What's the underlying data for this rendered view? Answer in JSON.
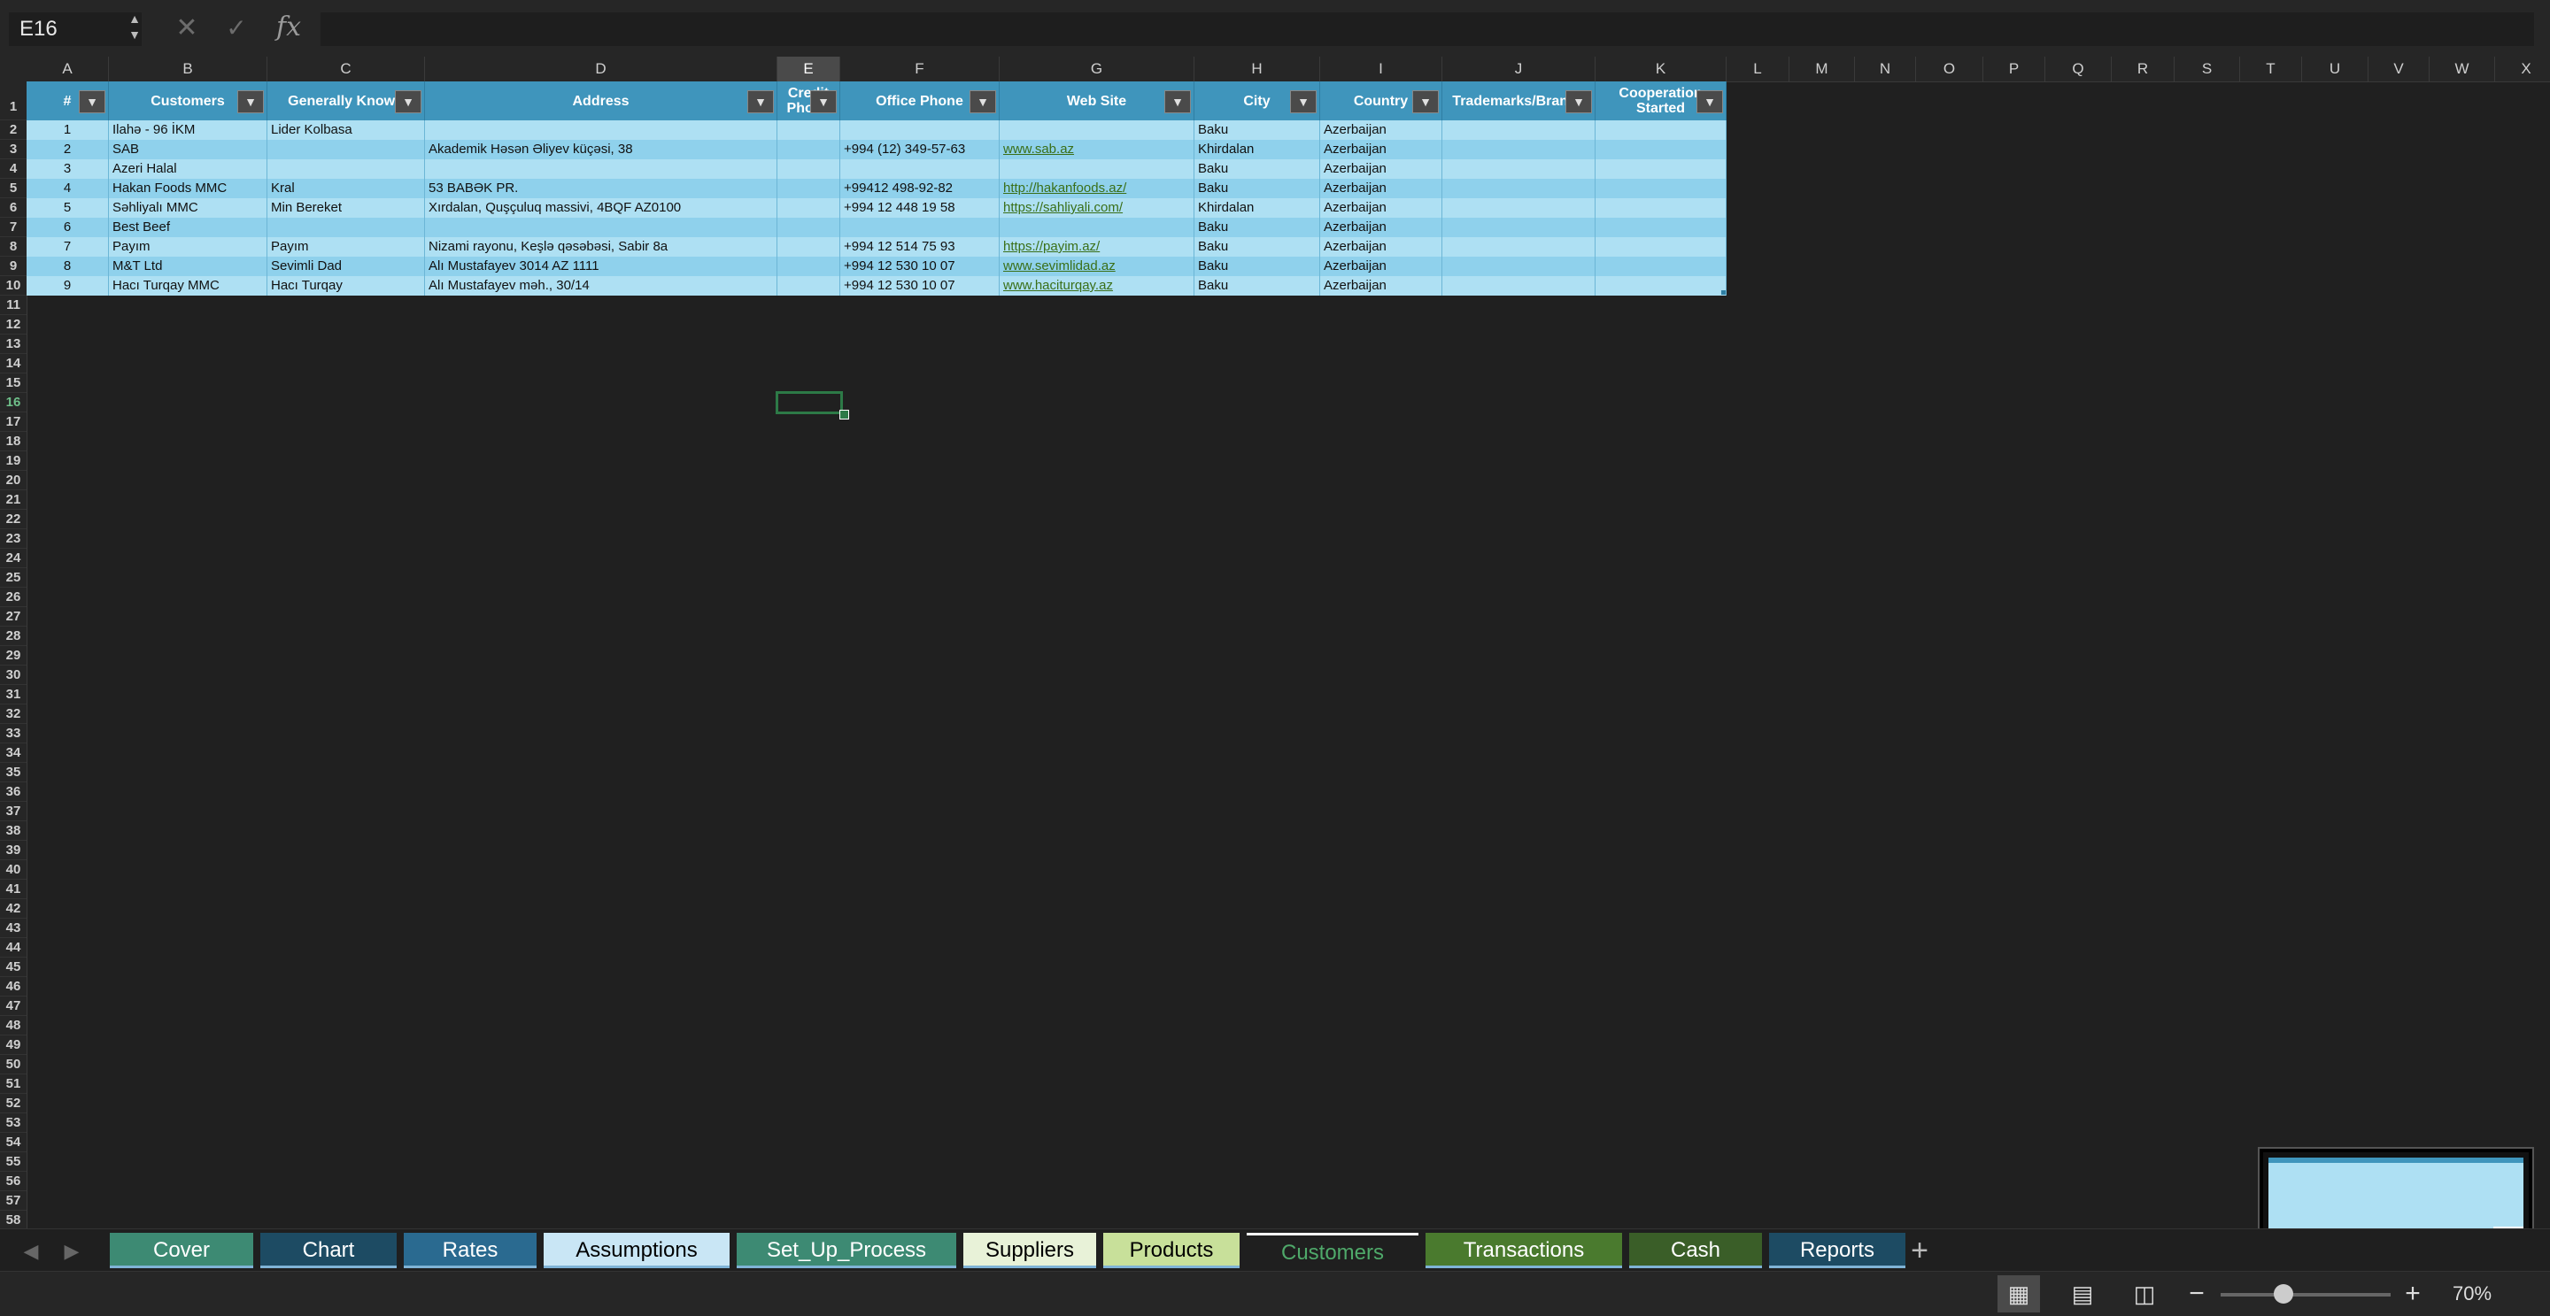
{
  "formula_bar": {
    "cell_ref": "E16",
    "fx_label": "fx",
    "cancel_glyph": "✕",
    "enter_glyph": "✓",
    "formula": ""
  },
  "columns": [
    "A",
    "B",
    "C",
    "D",
    "E",
    "F",
    "G",
    "H",
    "I",
    "J",
    "K",
    "L",
    "M",
    "N",
    "O",
    "P",
    "Q",
    "R",
    "S",
    "T",
    "U",
    "V",
    "W",
    "X"
  ],
  "selected_column": "E",
  "rows": [
    "1",
    "2",
    "3",
    "4",
    "5",
    "6",
    "7",
    "8",
    "9",
    "10",
    "11",
    "12",
    "13",
    "14",
    "15",
    "16",
    "17",
    "18",
    "19",
    "20",
    "21",
    "22",
    "23",
    "24",
    "25",
    "26",
    "27",
    "28",
    "29",
    "30",
    "31",
    "32",
    "33",
    "34",
    "35",
    "36",
    "37",
    "38",
    "39",
    "40",
    "41",
    "42",
    "43",
    "44",
    "45",
    "46",
    "47",
    "48",
    "49",
    "50",
    "51",
    "52",
    "53",
    "54",
    "55",
    "56",
    "57",
    "58"
  ],
  "selected_row": "16",
  "table": {
    "headers": [
      "#",
      "Customers",
      "Generally Known",
      "Address",
      "Credit\nPhone",
      "Office Phone",
      "Web Site",
      "City",
      "Country",
      "Trademarks/Brands",
      "Cooperation\nStarted"
    ],
    "rows": [
      [
        "1",
        "Ilahə - 96 İKM",
        "Lider Kolbasa",
        "",
        "",
        "",
        "",
        "Baku",
        "Azerbaijan",
        "",
        ""
      ],
      [
        "2",
        "SAB",
        "",
        "Akademik Həsən Əliyev küçəsi, 38",
        "",
        "+994 (12) 349-57-63",
        "www.sab.az",
        "Khirdalan",
        "Azerbaijan",
        "",
        ""
      ],
      [
        "3",
        "Azeri Halal",
        "",
        "",
        "",
        "",
        "",
        "Baku",
        "Azerbaijan",
        "",
        ""
      ],
      [
        "4",
        "Hakan Foods MMC",
        "Kral",
        "53 BABƏK PR.",
        "",
        "+99412 498-92-82",
        "http://hakanfoods.az/",
        "Baku",
        "Azerbaijan",
        "",
        ""
      ],
      [
        "5",
        "Səhliyalı MMC",
        "Min Bereket",
        "Xırdalan, Quşçuluq massivi, 4BQF AZ0100",
        "",
        "+994 12 448 19 58",
        "https://sahliyali.com/",
        "Khirdalan",
        "Azerbaijan",
        "",
        ""
      ],
      [
        "6",
        "Best Beef",
        "",
        "",
        "",
        "",
        "",
        "Baku",
        "Azerbaijan",
        "",
        ""
      ],
      [
        "7",
        "Payım",
        "Payım",
        "Nizami rayonu, Keşlə qəsəbəsi, Sabir 8a",
        "",
        "+994 12 514 75 93",
        "https://payim.az/",
        "Baku",
        "Azerbaijan",
        "",
        ""
      ],
      [
        "8",
        "M&T Ltd",
        "Sevimli Dad",
        "Alı Mustafayev 3014  AZ 1111",
        "",
        "+994 12 530 10 07",
        "www.sevimlidad.az",
        "Baku",
        "Azerbaijan",
        "",
        ""
      ],
      [
        "9",
        "Hacı Turqay MMC",
        "Hacı Turqay",
        "Alı Mustafayev məh., 30/14",
        "",
        "+994 12 530 10 07",
        "www.haciturqay.az",
        "Baku",
        "Azerbaijan",
        "",
        ""
      ]
    ]
  },
  "sheet_tabs": [
    "Cover",
    "Chart",
    "Rates",
    "Assumptions",
    "Set_Up_Process",
    "Suppliers",
    "Products",
    "Customers",
    "Transactions",
    "Cash",
    "Reports"
  ],
  "active_tab": "Customers",
  "tab_colors": {
    "Cover": "#3d8a73",
    "Chart": "#1d4b63",
    "Rates": "#2a6a90",
    "Assumptions": "#c9e6f5",
    "Set_Up_Process": "#3d8a73",
    "Suppliers": "#e8f2d8",
    "Products": "#c8e09a",
    "Customers": "#1f1f1f",
    "Transactions": "#4a7a2e",
    "Cash": "#3a5e28",
    "Reports": "#1d4b63"
  },
  "status": {
    "zoom": "70%",
    "zoom_level": 0.7
  }
}
